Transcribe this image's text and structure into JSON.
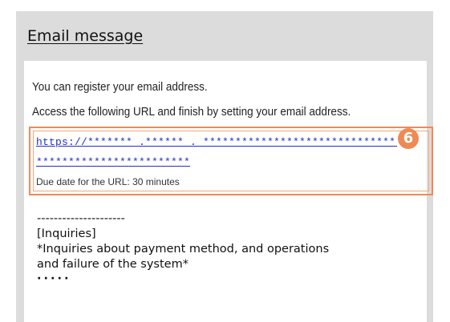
{
  "panel": {
    "title": "Email message",
    "background_color": "#dcdcdc"
  },
  "email": {
    "line1": "You can register your email address.",
    "line2": "Access the following URL and finish by setting your email address.",
    "url_line1": "https://******* .****** .  *******************************",
    "url_line2": "************************",
    "due_date": "Due date for the URL: 30 minutes",
    "highlight_color": "#ef8a55",
    "link_color": "#1f2fd0"
  },
  "badge": {
    "number": "6"
  },
  "footer": {
    "separator": "---------------------",
    "heading": "[Inquiries]",
    "text_line1": "*Inquiries about payment method, and operations",
    "text_line2": "and failure of the system*",
    "ellipsis": "·····"
  }
}
